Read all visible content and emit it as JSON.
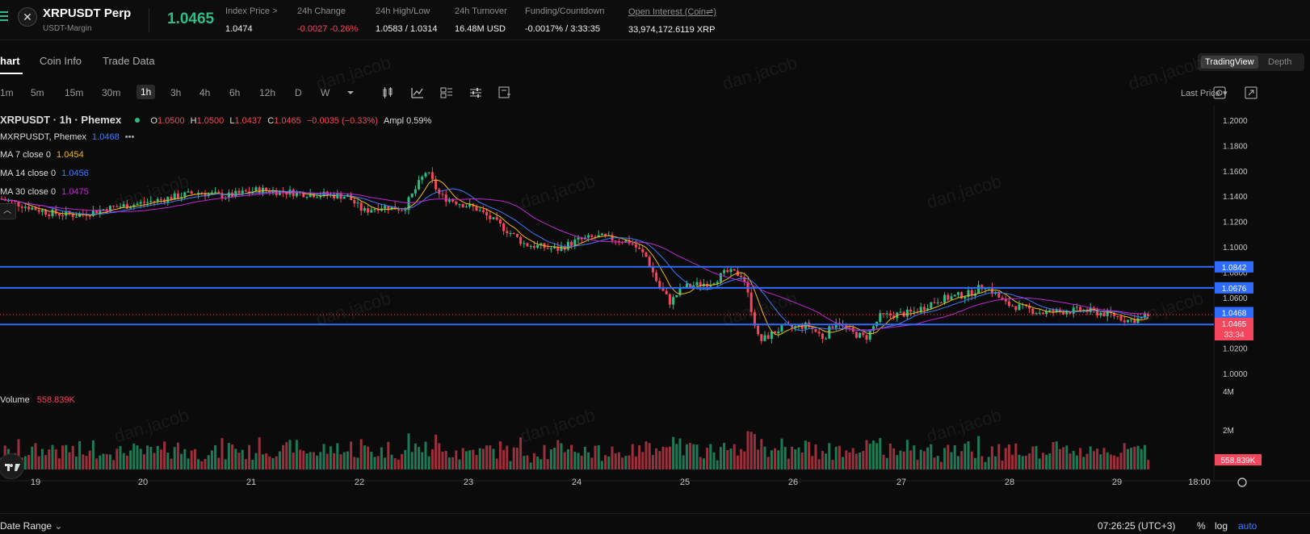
{
  "header": {
    "symbol": "XRPUSDT Perp",
    "margin": "USDT-Margin",
    "last_price": "1.0465",
    "stats": [
      {
        "label": "Index Price >",
        "value": "1.0474",
        "neg": false
      },
      {
        "label": "24h Change",
        "value": "-0.0027 -0.26%",
        "neg": true
      },
      {
        "label": "24h High/Low",
        "value": "1.0583 / 1.0314",
        "neg": false
      },
      {
        "label": "24h Turnover",
        "value": "16.48M USD",
        "neg": false
      },
      {
        "label": "Funding/Countdown",
        "value": "-0.0017% / 3:33:35",
        "neg": false
      },
      {
        "label": "Open Interest (Coin⇌)",
        "value": "33,974,172.6119 XRP",
        "neg": false
      }
    ]
  },
  "tabs": [
    "hart",
    "Coin Info",
    "Trade Data"
  ],
  "view_toggle": [
    "TradingView",
    "Depth"
  ],
  "timeframes": [
    "1m",
    "5m",
    "15m",
    "30m",
    "1h",
    "3h",
    "4h",
    "6h",
    "12h",
    "D",
    "W"
  ],
  "active_timeframe": "1h",
  "price_source": "Last Price",
  "legend": {
    "title": "XRPUSDT · 1h · Phemex",
    "ohlc": [
      {
        "k": "O",
        "v": "1.0500"
      },
      {
        "k": "H",
        "v": "1.0500"
      },
      {
        "k": "L",
        "v": "1.0437"
      },
      {
        "k": "C",
        "v": "1.0465"
      }
    ],
    "change": "−0.0035 (−0.33%)",
    "ampl": "Ampl 0.59%",
    "mark": {
      "label": "MXRPUSDT, Phemex",
      "value": "1.0468"
    },
    "ma": [
      {
        "label": "MA 7 close 0",
        "value": "1.0454",
        "color": "#f0b90b"
      },
      {
        "label": "MA 14 close 0",
        "value": "1.0456",
        "color": "#3d7bfd"
      },
      {
        "label": "MA 30 close 0",
        "value": "1.0475",
        "color": "#c026d3"
      }
    ],
    "volume_label": "Volume",
    "volume_value": "558.839K"
  },
  "colors": {
    "up": "#2ebd85",
    "down": "#f6465d",
    "level": "#2f6bff",
    "bg": "#0b0b0b"
  },
  "watermark": "dan.jacob",
  "price_axis": [
    "1.2000",
    "1.1800",
    "1.1600",
    "1.1400",
    "1.1200",
    "1.1000",
    "1.0800",
    "1.0600",
    "1.0400",
    "1.0200",
    "1.0000"
  ],
  "horizontal_levels": [
    "1.0842",
    "1.0676",
    "1.0387"
  ],
  "tags": {
    "mark": "1.0468",
    "last": "1.0465",
    "countdown": "33:34",
    "volume_last": "558.839K"
  },
  "volume_axis": [
    "4M",
    "2M"
  ],
  "date_axis": [
    "19",
    "20",
    "21",
    "22",
    "23",
    "24",
    "25",
    "26",
    "27",
    "28",
    "29",
    "18:00"
  ],
  "bottom": {
    "date_range": "Date Range",
    "clock": "07:26:25 (UTC+3)",
    "pct": "%",
    "log": "log",
    "auto": "auto"
  },
  "chart_data": {
    "type": "candlestick",
    "symbol": "XRPUSDT",
    "interval": "1h",
    "ylim": [
      1.0,
      1.2
    ],
    "x": [
      "19",
      "20",
      "21",
      "22",
      "23",
      "24",
      "25",
      "26",
      "27",
      "28",
      "29"
    ],
    "close_approx": [
      1.14,
      1.135,
      1.144,
      1.14,
      1.135,
      1.108,
      1.08,
      1.032,
      1.045,
      1.045,
      1.0465
    ],
    "levels": [
      1.0842,
      1.0676,
      1.0387
    ],
    "last_volume": "558.839K"
  }
}
